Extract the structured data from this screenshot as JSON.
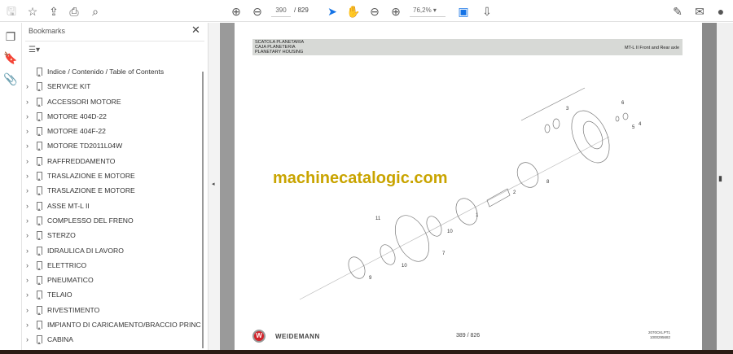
{
  "toolbar": {
    "icons": [
      "save-icon",
      "star-icon",
      "upload-icon",
      "print-icon",
      "search-icon",
      "prev-page-icon",
      "next-page-icon",
      "select-cursor-icon",
      "hand-icon",
      "zoom-out-icon",
      "zoom-in-icon",
      "fit-page-icon",
      "scroll-mode-icon",
      "sign-icon",
      "mail-icon",
      "account-icon"
    ],
    "current_page": "390",
    "total_pages": "/ 829",
    "zoom": "76,2%"
  },
  "bookmarks": {
    "title": "Bookmarks",
    "items": [
      {
        "label": "Indice / Contenido / Table of Contents",
        "expandable": false
      },
      {
        "label": "SERVICE KIT",
        "expandable": true
      },
      {
        "label": "ACCESSORI MOTORE",
        "expandable": true
      },
      {
        "label": "MOTORE 404D-22",
        "expandable": true
      },
      {
        "label": "MOTORE 404F-22",
        "expandable": true
      },
      {
        "label": "MOTORE TD2011L04W",
        "expandable": true
      },
      {
        "label": "RAFFREDDAMENTO",
        "expandable": true
      },
      {
        "label": "TRASLAZIONE E MOTORE",
        "expandable": true
      },
      {
        "label": "TRASLAZIONE E MOTORE",
        "expandable": true
      },
      {
        "label": "ASSE MT-L II",
        "expandable": true
      },
      {
        "label": "COMPLESSO DEL FRENO",
        "expandable": true
      },
      {
        "label": "STERZO",
        "expandable": true
      },
      {
        "label": "IDRAULICA DI LAVORO",
        "expandable": true
      },
      {
        "label": "ELETTRICO",
        "expandable": true
      },
      {
        "label": "PNEUMATICO",
        "expandable": true
      },
      {
        "label": "TELAIO",
        "expandable": true
      },
      {
        "label": "RIVESTIMENTO",
        "expandable": true
      },
      {
        "label": "IMPIANTO DI CARICAMENTO/BRACCIO PRINCIPALE",
        "expandable": true
      },
      {
        "label": "CABINA",
        "expandable": true
      }
    ]
  },
  "document": {
    "header_lines": [
      "SCATOLA PLANETARIA",
      "CAJA PLANETERIA",
      "PLANETARY HOUSING"
    ],
    "header_right": "MT-L II Front and Rear axle",
    "watermark": "machinecatalogic.com",
    "brand": "WEIDEMANN",
    "page_label": "389 / 826",
    "code_lines": [
      "2070CKLPT1",
      "1000295682"
    ],
    "callouts": [
      "1",
      "2",
      "3",
      "4",
      "5",
      "6",
      "7",
      "8",
      "9",
      "10",
      "10",
      "11"
    ]
  },
  "colors": {
    "accent": "#1473e6",
    "watermark": "#c9a400",
    "brand": "#d2232a"
  }
}
